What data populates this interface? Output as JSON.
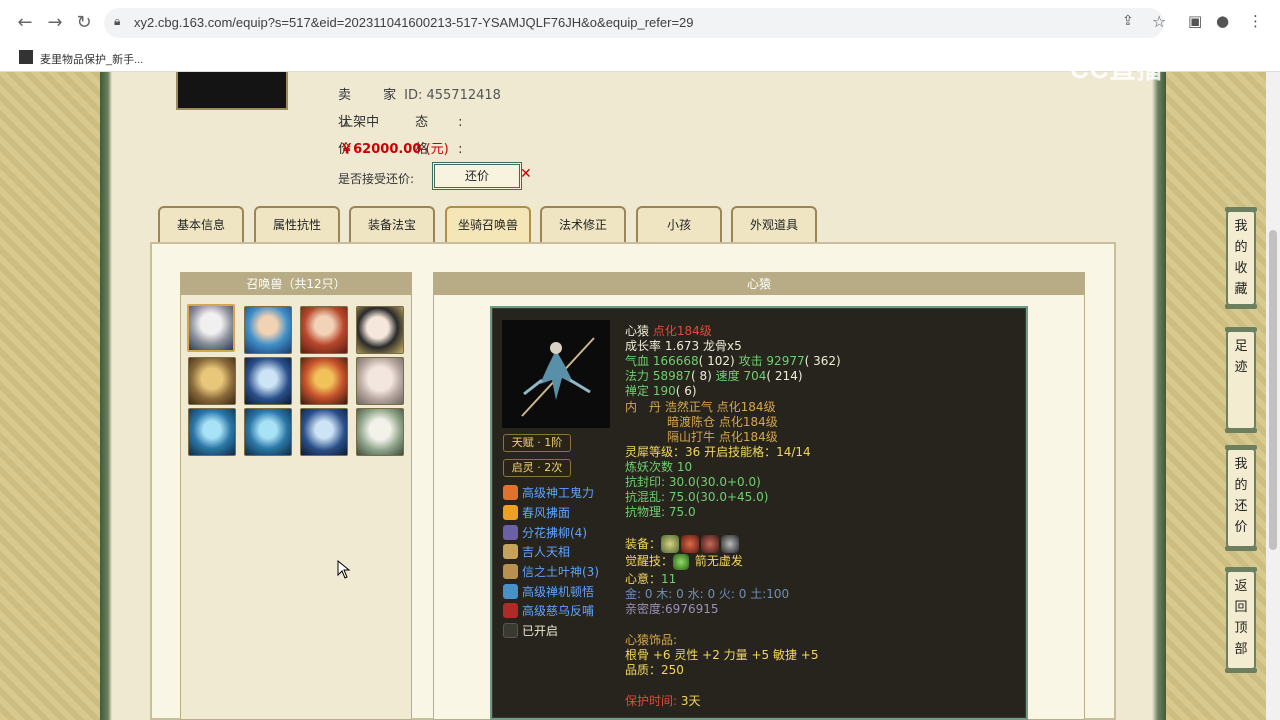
{
  "browser": {
    "url": "xy2.cbg.163.com/equip?s=517&eid=202311041600213-517-YSAMJQLF76JH&o&equip_refer=29",
    "bookmark": "麦里物品保护_新手..."
  },
  "watermark": "CC直播",
  "seller": {
    "seller_label": "卖 家",
    "seller_value": "ID: 455712418",
    "status_label": "状 态:",
    "status_value": "上架中",
    "price_label": "价 格:",
    "price_value": "￥62000.00",
    "price_unit": "(元)",
    "bargain_label": "是否接受还价:",
    "bargain_button": "还价"
  },
  "tabs": [
    "基本信息",
    "属性抗性",
    "装备法宝",
    "坐骑召唤兽",
    "法术修正",
    "小孩",
    "外观道具"
  ],
  "active_tab": "坐骑召唤兽",
  "pets": {
    "header": "召唤兽（共12只）",
    "count": 12
  },
  "detail": {
    "header": "心猿",
    "badges": [
      "天赋 · 1阶",
      "启灵 · 2次"
    ],
    "skills": [
      {
        "name": "高级神工鬼力",
        "icon": "fist-icon"
      },
      {
        "name": "春风拂面",
        "icon": "flame-icon"
      },
      {
        "name": "分花拂柳(4)",
        "icon": "blade-icon"
      },
      {
        "name": "吉人天相",
        "icon": "luck-icon"
      },
      {
        "name": "信之土叶神(3)",
        "icon": "earth-icon"
      },
      {
        "name": "高级禅机顿悟",
        "icon": "zen-icon"
      },
      {
        "name": "高级慈乌反哺",
        "icon": "crow-icon"
      },
      {
        "name": "已开启",
        "icon": "empty-slot-icon"
      }
    ],
    "name": "心猿",
    "name_suffix": "点化184级",
    "growth": "成长率 1.673 龙骨x5",
    "hp_label": "气血",
    "hp": "166668",
    "hp_extra": "( 102)",
    "atk_label": "攻击",
    "atk": "92977",
    "atk_extra": "( 362)",
    "mp_label": "法力",
    "mp": "58987",
    "mp_extra": "( 8)",
    "spd_label": "速度",
    "spd": "704",
    "spd_extra": "( 214)",
    "zen_label": "禅定",
    "zen": "190",
    "zen_extra": "( 6)",
    "neidan_label": "内　丹",
    "neidan": [
      "浩然正气 点化184级",
      "暗渡陈仓 点化184级",
      "隔山打牛 点化184级"
    ],
    "spirit_level": "灵犀等级：36 开启技能格：14/14",
    "refine": "炼妖次数 10",
    "resist_seal_label": "抗封印:",
    "resist_seal": "30.0(30.0+0.0)",
    "resist_chaos_label": "抗混乱:",
    "resist_chaos": "75.0(30.0+45.0)",
    "resist_phys_label": "抗物理:",
    "resist_phys": "75.0",
    "equip_label": "装备：",
    "equips": [
      "jade-icon",
      "beast-a-icon",
      "beast-b-icon",
      "hook-icon"
    ],
    "awaken_label": "觉醒技：",
    "awaken": "箭无虚发",
    "heart_label": "心意：",
    "heart": "11",
    "elements": "金: 0 木: 0 水: 0 火: 0 土:100",
    "intimacy": "亲密度:6976915",
    "ornament_label": "心猿饰品:",
    "ornament_stats": "根骨 +6 灵性 +2 力量 +5 敏捷 +5",
    "quality": "品质：250",
    "protect_label": "保护时间:",
    "protect_value": "3天"
  },
  "side_buttons": [
    "我的收藏",
    "足迹",
    "我的还价",
    "返回顶部"
  ]
}
